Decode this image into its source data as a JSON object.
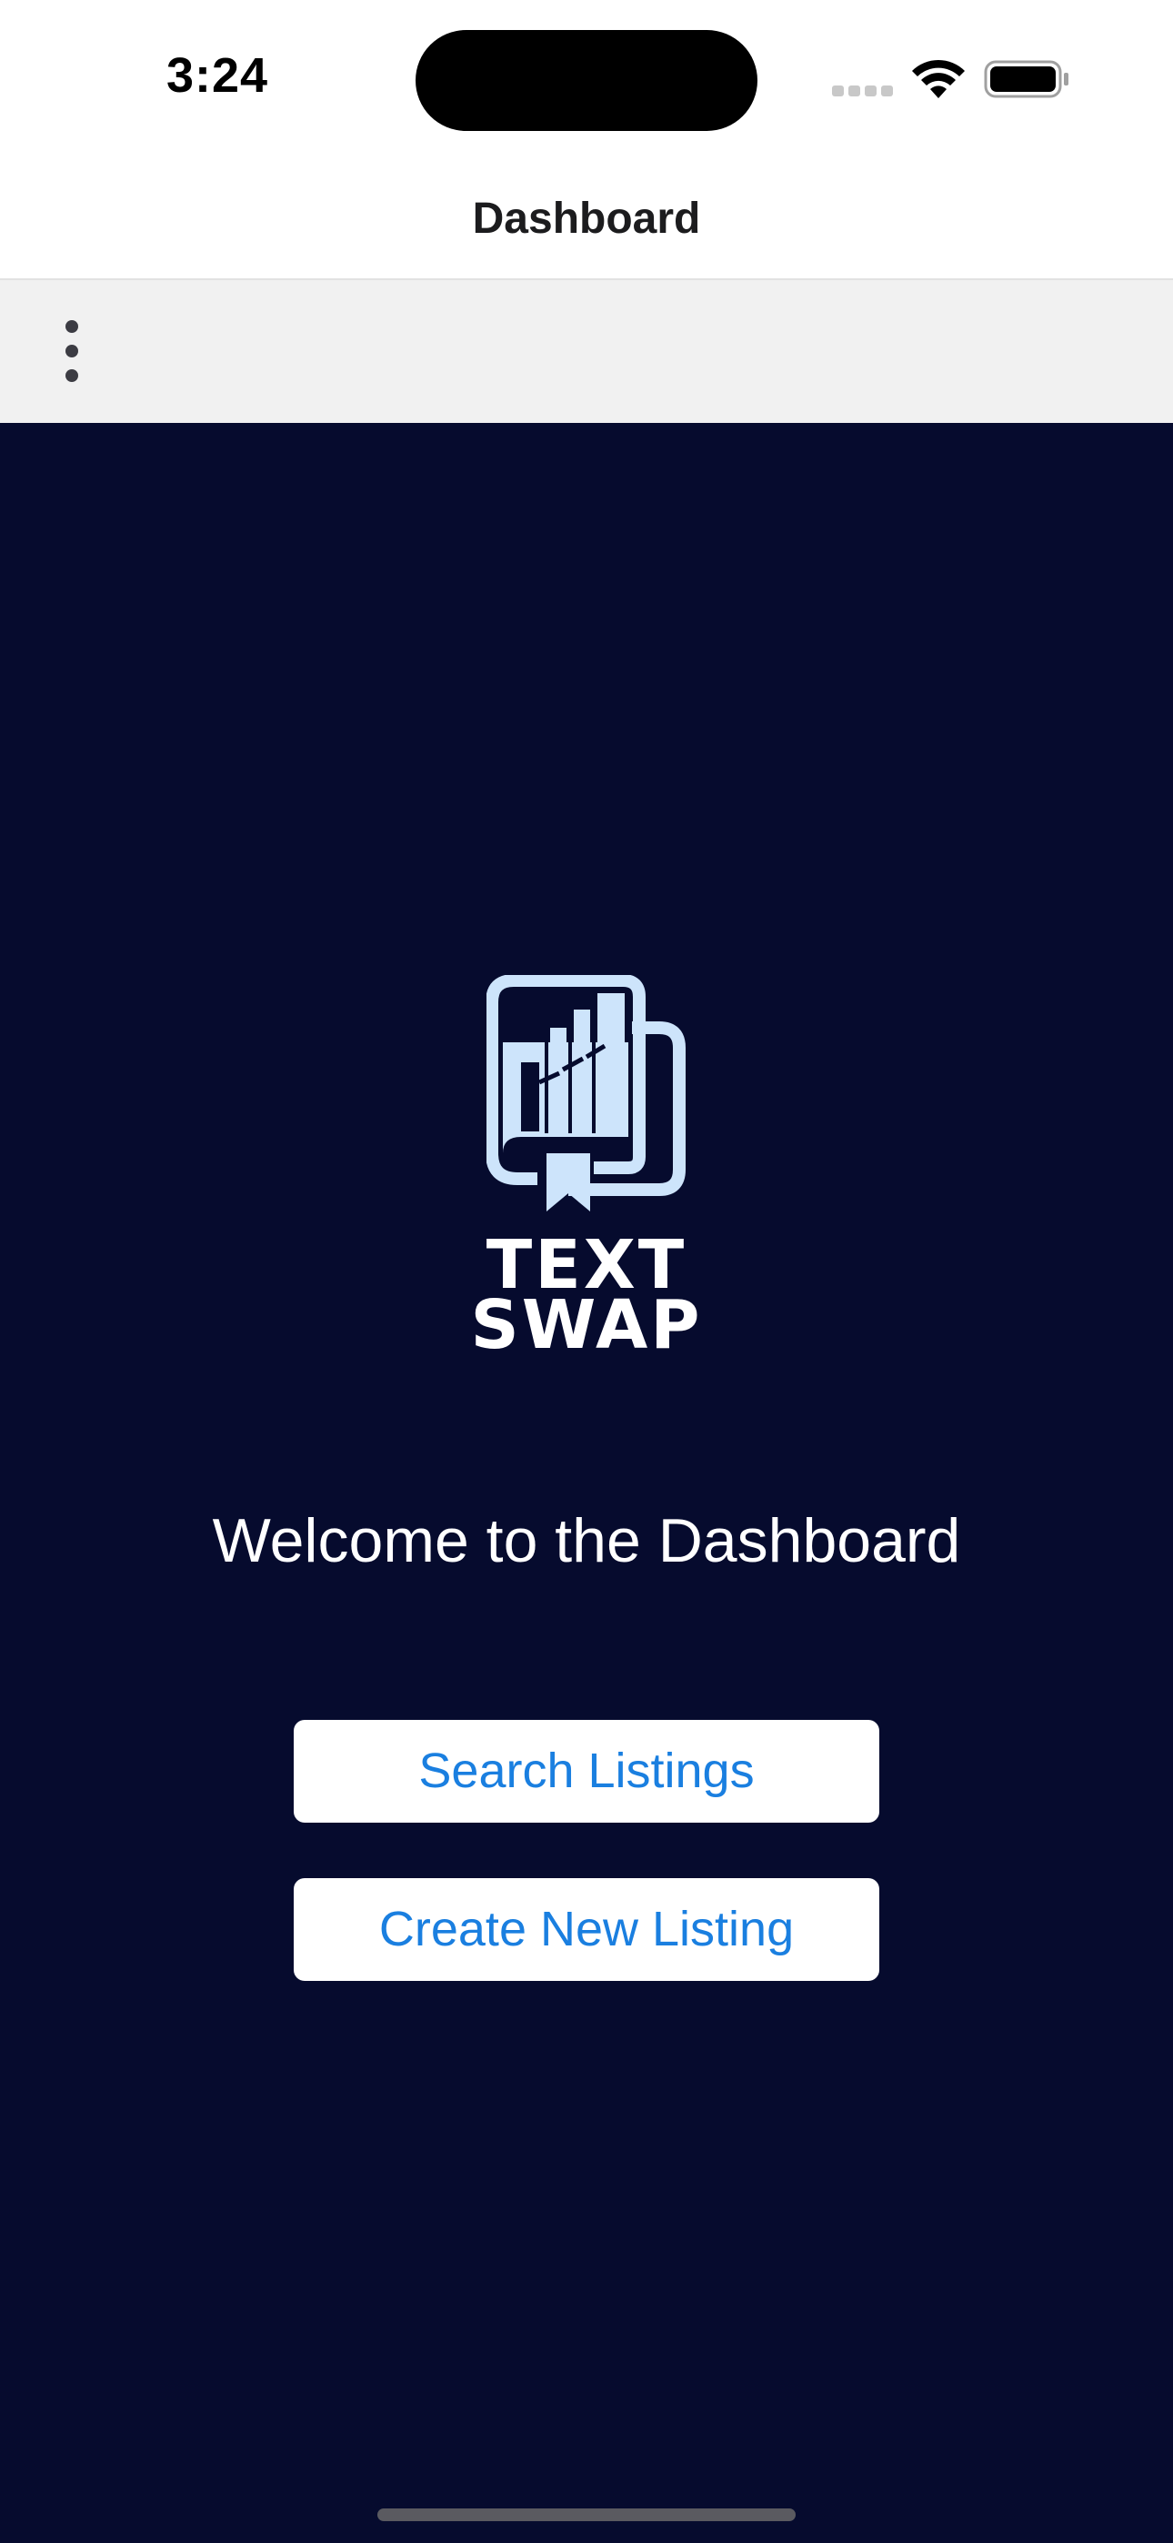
{
  "status_bar": {
    "time": "3:24"
  },
  "nav": {
    "title": "Dashboard"
  },
  "toolbar": {
    "menu_icon": "vertical-ellipsis-icon"
  },
  "logo": {
    "line1": "TEXT",
    "line2": "SWAP",
    "icon": "book-bar-chart-logo",
    "color": "#cde4fb"
  },
  "main": {
    "welcome": "Welcome to the Dashboard",
    "search_label": "Search Listings",
    "create_label": "Create New Listing"
  },
  "colors": {
    "background": "#060b2e",
    "accent": "#1a7fe0",
    "toolbar": "#f1f1f1"
  }
}
